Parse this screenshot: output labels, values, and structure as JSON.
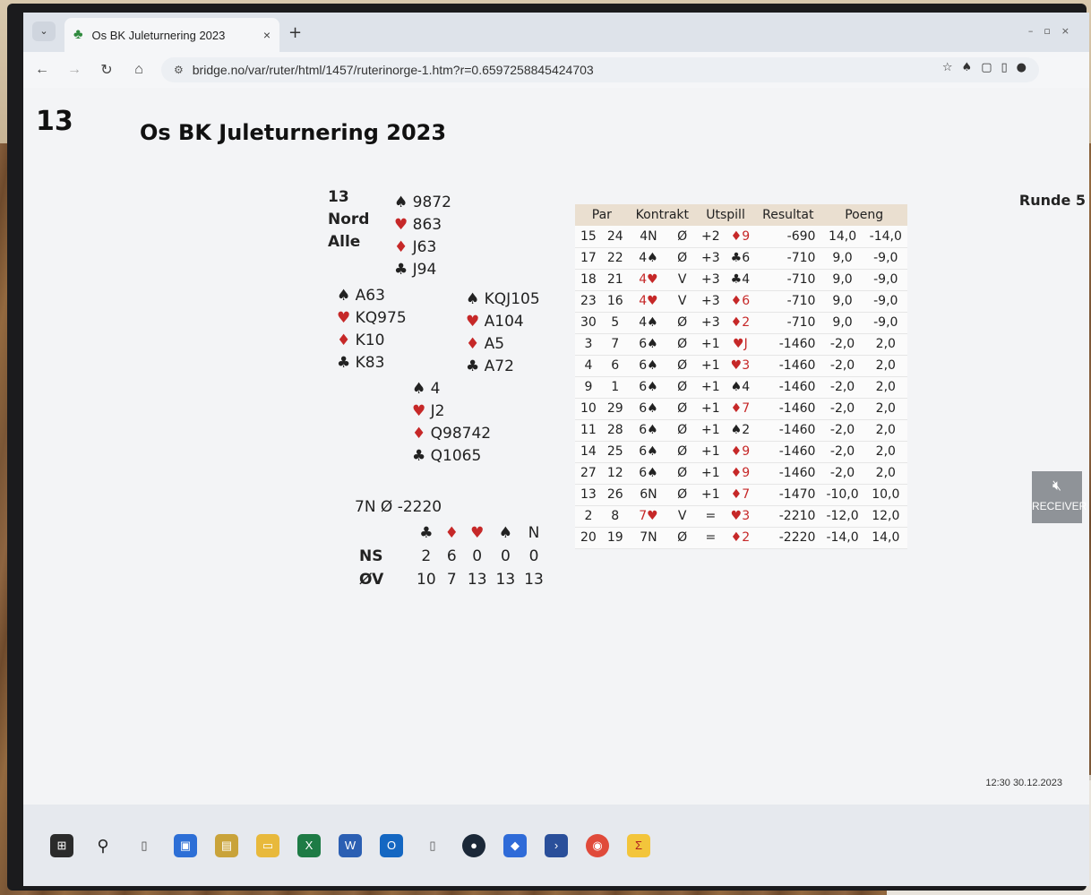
{
  "browser": {
    "tab_title": "Os BK Juleturnering 2023",
    "tab_close": "×",
    "new_tab": "+",
    "url": "bridge.no/var/ruter/html/1457/ruterinorge-1.htm?r=0.6597258845424703"
  },
  "page": {
    "board_number": "13",
    "title": "Os BK Juleturnering 2023",
    "round": "Runde 5"
  },
  "deal": {
    "info": [
      "13",
      "Nord",
      "Alle"
    ],
    "north": [
      {
        "s": "♠",
        "c": "9872"
      },
      {
        "s": "♥",
        "c": "863"
      },
      {
        "s": "♦",
        "c": "J63"
      },
      {
        "s": "♣",
        "c": "J94"
      }
    ],
    "west": [
      {
        "s": "♠",
        "c": "A63"
      },
      {
        "s": "♥",
        "c": "KQ975"
      },
      {
        "s": "♦",
        "c": "K10"
      },
      {
        "s": "♣",
        "c": "K83"
      }
    ],
    "east": [
      {
        "s": "♠",
        "c": "KQJ105"
      },
      {
        "s": "♥",
        "c": "A104"
      },
      {
        "s": "♦",
        "c": "A5"
      },
      {
        "s": "♣",
        "c": "A72"
      }
    ],
    "south": [
      {
        "s": "♠",
        "c": "4"
      },
      {
        "s": "♥",
        "c": "J2"
      },
      {
        "s": "♦",
        "c": "Q98742"
      },
      {
        "s": "♣",
        "c": "Q1065"
      }
    ]
  },
  "double_dummy": {
    "contract": "7N Ø -2220",
    "headers": [
      "♣",
      "♦",
      "♥",
      "♠",
      "N"
    ],
    "rows": [
      {
        "label": "NS",
        "values": [
          "2",
          "6",
          "0",
          "0",
          "0"
        ]
      },
      {
        "label": "ØV",
        "values": [
          "10",
          "7",
          "13",
          "13",
          "13"
        ]
      }
    ]
  },
  "results": {
    "headers": [
      "Par",
      "Kontrakt",
      "Utspill",
      "Resultat",
      "Poeng"
    ],
    "rows": [
      [
        "15",
        "24",
        "4N",
        "Ø",
        "+2",
        "♦9",
        "-690",
        "14,0",
        "-14,0"
      ],
      [
        "17",
        "22",
        "4♠",
        "Ø",
        "+3",
        "♣6",
        "-710",
        "9,0",
        "-9,0"
      ],
      [
        "18",
        "21",
        "4♥",
        "V",
        "+3",
        "♣4",
        "-710",
        "9,0",
        "-9,0"
      ],
      [
        "23",
        "16",
        "4♥",
        "V",
        "+3",
        "♦6",
        "-710",
        "9,0",
        "-9,0"
      ],
      [
        "30",
        "5",
        "4♠",
        "Ø",
        "+3",
        "♦2",
        "-710",
        "9,0",
        "-9,0"
      ],
      [
        "3",
        "7",
        "6♠",
        "Ø",
        "+1",
        "♥J",
        "-1460",
        "-2,0",
        "2,0"
      ],
      [
        "4",
        "6",
        "6♠",
        "Ø",
        "+1",
        "♥3",
        "-1460",
        "-2,0",
        "2,0"
      ],
      [
        "9",
        "1",
        "6♠",
        "Ø",
        "+1",
        "♠4",
        "-1460",
        "-2,0",
        "2,0"
      ],
      [
        "10",
        "29",
        "6♠",
        "Ø",
        "+1",
        "♦7",
        "-1460",
        "-2,0",
        "2,0"
      ],
      [
        "11",
        "28",
        "6♠",
        "Ø",
        "+1",
        "♠2",
        "-1460",
        "-2,0",
        "2,0"
      ],
      [
        "14",
        "25",
        "6♠",
        "Ø",
        "+1",
        "♦9",
        "-1460",
        "-2,0",
        "2,0"
      ],
      [
        "27",
        "12",
        "6♠",
        "Ø",
        "+1",
        "♦9",
        "-1460",
        "-2,0",
        "2,0"
      ],
      [
        "13",
        "26",
        "6N",
        "Ø",
        "+1",
        "♦7",
        "-1470",
        "-10,0",
        "10,0"
      ],
      [
        "2",
        "8",
        "7♥",
        "V",
        "=",
        "♥3",
        "-2210",
        "-12,0",
        "12,0"
      ],
      [
        "20",
        "19",
        "7N",
        "Ø",
        "=",
        "♦2",
        "-2220",
        "-14,0",
        "14,0"
      ]
    ]
  },
  "receiver": {
    "label": "RECEIVER"
  },
  "tray": {
    "time": "12:30",
    "date": "30.12.2023"
  }
}
